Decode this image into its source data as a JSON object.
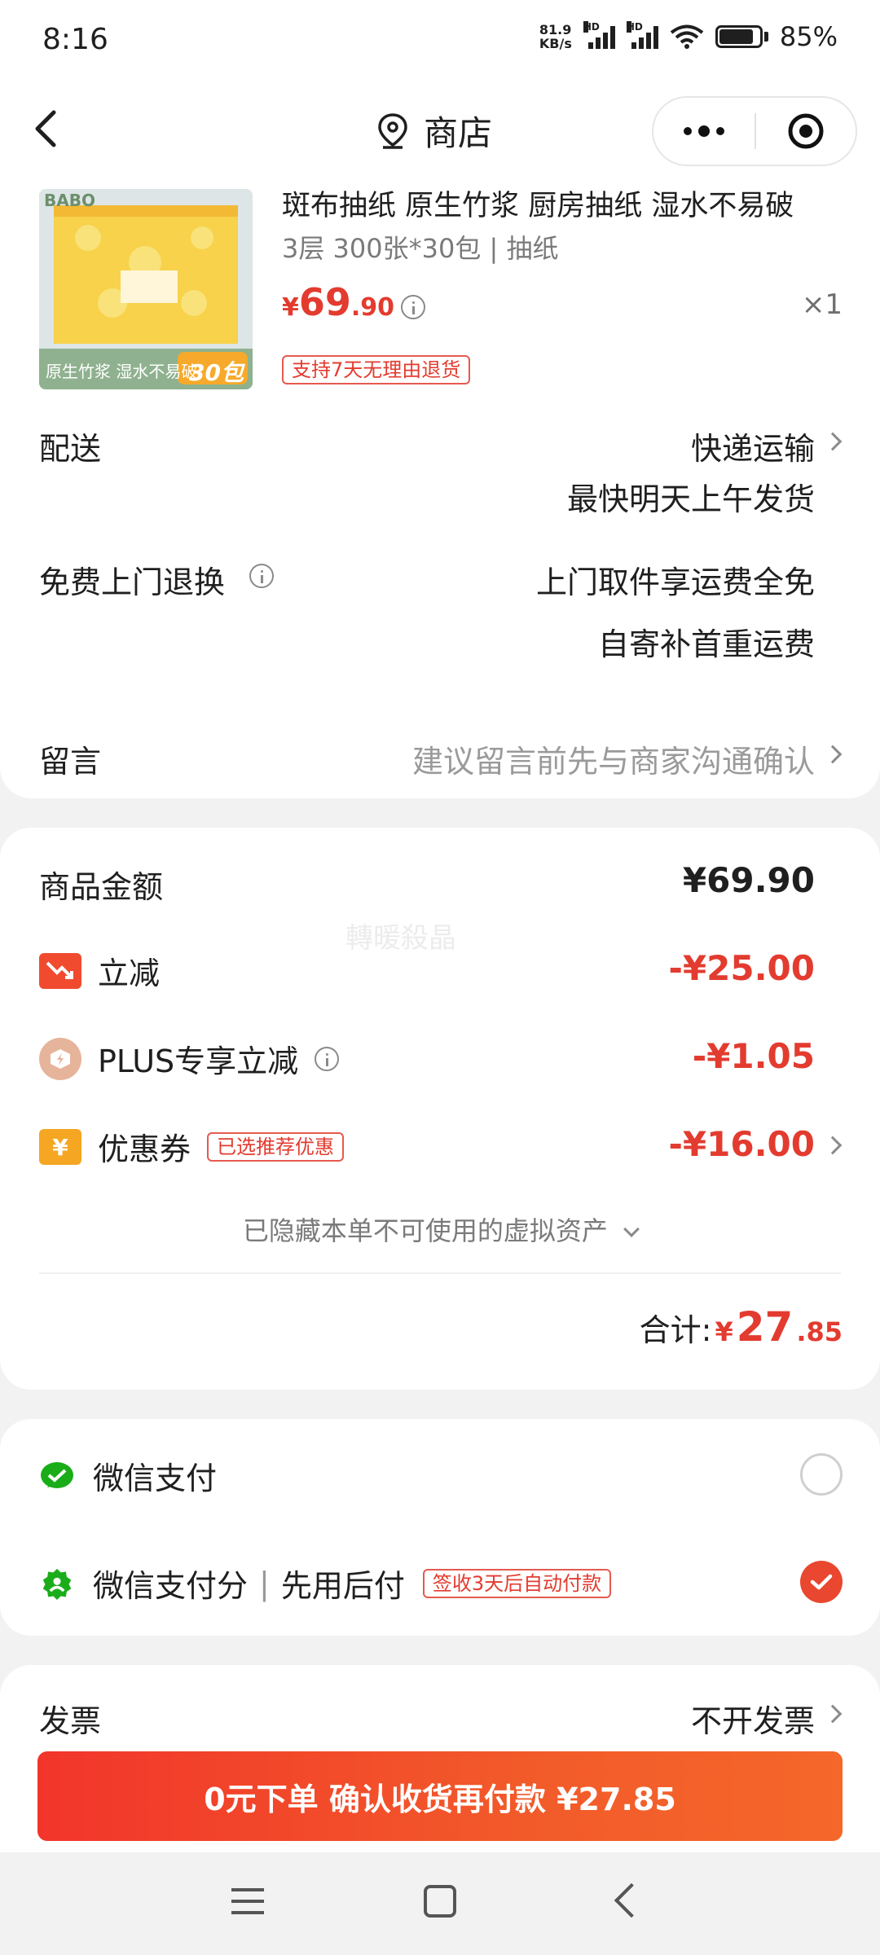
{
  "status_bar": {
    "time": "8:16",
    "net_speed_value": "81.9",
    "net_speed_unit": "KB/s",
    "signal_label": "HD",
    "battery_percent": "85%",
    "battery_level": 0.85
  },
  "nav": {
    "title": "商店"
  },
  "product": {
    "title": "斑布抽纸 原生竹浆 厨房抽纸 湿水不易破",
    "spec": "3层 300张*30包 | 抽纸",
    "price_symbol": "¥",
    "price_int": "69",
    "price_dec": ".90",
    "quantity": "×1",
    "return_badge": "支持7天无理由退货",
    "image_caption": "原生竹浆 湿水不易破",
    "image_pack": "30包",
    "image_brand": "BABO"
  },
  "shipping": {
    "label": "配送",
    "method": "快递运输",
    "time": "最快明天上午发货"
  },
  "free_return": {
    "label": "免费上门退换",
    "line1": "上门取件享运费全免",
    "line2": "自寄补首重运费"
  },
  "note": {
    "label": "留言",
    "hint": "建议留言前先与商家沟通确认"
  },
  "summary": {
    "goods_label": "商品金额",
    "goods_amount": "¥69.90",
    "discount_label": "立减",
    "discount_amount": "-¥25.00",
    "plus_label": "PLUS专享立减",
    "plus_amount": "-¥1.05",
    "coupon_label": "优惠券",
    "coupon_badge": "已选推荐优惠",
    "coupon_amount": "-¥16.00",
    "hidden_assets": "已隐藏本单不可使用的虚拟资产",
    "total_label": "合计:",
    "total_symbol": "¥",
    "total_int": "27",
    "total_dec": ".85",
    "watermark": "轉暖殺晶"
  },
  "payment": {
    "wechat_label": "微信支付",
    "wechat_score_label": "微信支付分",
    "separator": "|",
    "pay_later_label": "先用后付",
    "pay_later_badge": "签收3天后自动付款",
    "selected": "wechat_score"
  },
  "invoice": {
    "label": "发票",
    "value": "不开发票"
  },
  "action": {
    "submit_label": "0元下单 确认收货再付款 ¥27.85"
  },
  "colors": {
    "accent_red": "#e33b2f",
    "button_start": "#f2352b",
    "button_end": "#f5672a",
    "wechat_green": "#1aad19"
  }
}
